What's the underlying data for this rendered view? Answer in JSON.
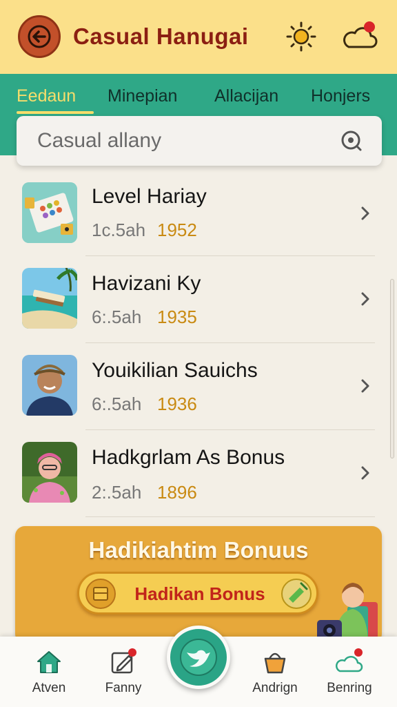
{
  "header": {
    "title": "Casual Hanugai",
    "back_icon": "arrow-left-icon",
    "weather_icon": "sun-icon",
    "notification_icon": "cloud-icon"
  },
  "tabs": [
    {
      "label": "Eedaun",
      "active": true
    },
    {
      "label": "Minepian",
      "active": false
    },
    {
      "label": "Allacijan",
      "active": false
    },
    {
      "label": "Honjers",
      "active": false
    }
  ],
  "search": {
    "placeholder": "Casual allany"
  },
  "list": [
    {
      "title": "Level Hariay",
      "subtitle": "1c.5ah",
      "year": "1952",
      "thumb": "board-game"
    },
    {
      "title": "Havizani Ky",
      "subtitle": "6:.5ah",
      "year": "1935",
      "thumb": "beach"
    },
    {
      "title": "Youikilian Sauichs",
      "subtitle": "6:.5ah",
      "year": "1936",
      "thumb": "portrait"
    },
    {
      "title": "Hadkgrlam As Bonus",
      "subtitle": "2:.5ah",
      "year": "1896",
      "thumb": "child"
    }
  ],
  "bonus": {
    "title": "Hadikiahtim Bonuus",
    "button_label": "Hadikan Bonus"
  },
  "bottom_nav": [
    {
      "label": "Atven",
      "icon": "home-icon"
    },
    {
      "label": "Fanny",
      "icon": "edit-icon"
    },
    {
      "label": "",
      "icon": "bird-icon"
    },
    {
      "label": "Andrign",
      "icon": "basket-icon"
    },
    {
      "label": "Benring",
      "icon": "cloud-icon"
    }
  ],
  "colors": {
    "header_bg": "#fbe08a",
    "tab_bg": "#2fa887",
    "accent_gold": "#c98a12",
    "title_red": "#8b1f12"
  }
}
